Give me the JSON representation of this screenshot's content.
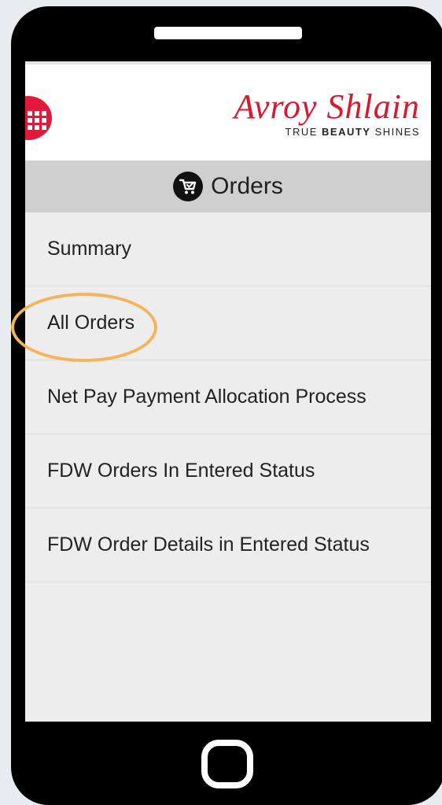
{
  "brand": {
    "name": "Avroy Shlain",
    "tagline_prefix": "TRUE ",
    "tagline_bold": "BEAUTY",
    "tagline_suffix": " SHINES",
    "color": "#d7192f"
  },
  "menu_icon": "grid-icon",
  "section": {
    "icon": "cart-icon",
    "title": "Orders"
  },
  "menu": {
    "items": [
      {
        "label": "Summary"
      },
      {
        "label": "All Orders"
      },
      {
        "label": "Net Pay Payment Allocation Process"
      },
      {
        "label": "FDW Orders In Entered Status"
      },
      {
        "label": "FDW Order Details in Entered Status"
      }
    ]
  },
  "highlight_color": "#f5b35a"
}
